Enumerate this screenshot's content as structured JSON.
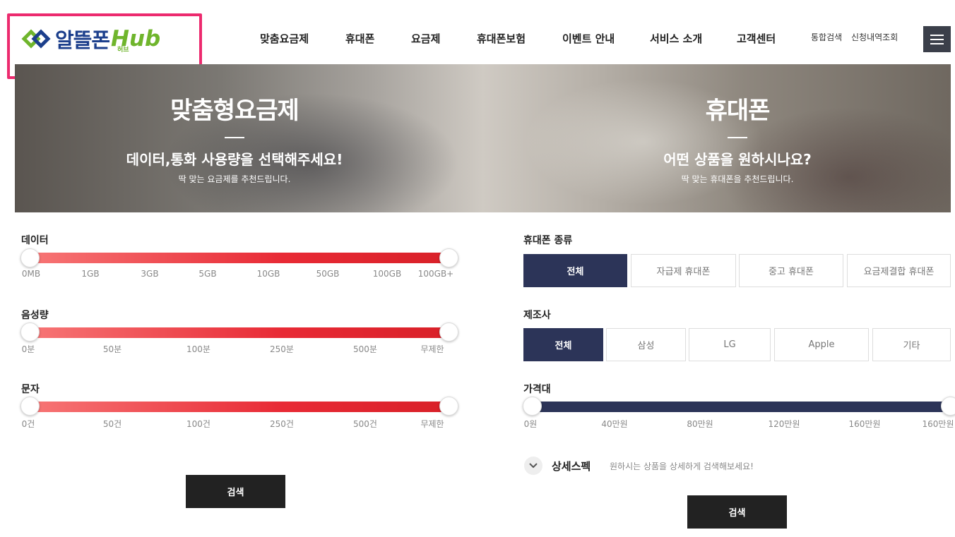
{
  "header": {
    "logo_text": "알뜰폰",
    "logo_hub": "Hub",
    "logo_sub": "허브",
    "nav": [
      "맞춤요금제",
      "휴대폰",
      "요금제",
      "휴대폰보험",
      "이벤트 안내",
      "서비스 소개",
      "고객센터"
    ],
    "util_search": "통합검색",
    "util_history": "신청내역조회"
  },
  "banner": {
    "left": {
      "title": "맞춤형요금제",
      "subtitle": "데이터,통화 사용량을 선택해주세요!",
      "small": "딱 맞는 요금제를 추천드립니다."
    },
    "right": {
      "title": "휴대폰",
      "subtitle": "어떤 상품을 원하시나요?",
      "small": "딱 맞는 휴대폰을 추천드립니다."
    }
  },
  "plan": {
    "data": {
      "label": "데이터",
      "ticks": [
        "0MB",
        "1GB",
        "3GB",
        "5GB",
        "10GB",
        "50GB",
        "100GB",
        "100GB+"
      ],
      "min_index": 0,
      "max_index": 7
    },
    "voice": {
      "label": "음성량",
      "ticks": [
        "0분",
        "50분",
        "100분",
        "250분",
        "500분",
        "무제한"
      ],
      "min_index": 0,
      "max_index": 5
    },
    "sms": {
      "label": "문자",
      "ticks": [
        "0건",
        "50건",
        "100건",
        "250건",
        "500건",
        "무제한"
      ],
      "min_index": 0,
      "max_index": 5
    },
    "search_label": "검색"
  },
  "phone": {
    "type": {
      "label": "휴대폰 종류",
      "options": [
        "전체",
        "자급제 휴대폰",
        "중고 휴대폰",
        "요금제결합 휴대폰"
      ],
      "selected": "전체"
    },
    "maker": {
      "label": "제조사",
      "options": [
        "전체",
        "삼성",
        "LG",
        "Apple",
        "기타"
      ],
      "selected": "전체"
    },
    "price": {
      "label": "가격대",
      "ticks": [
        "0원",
        "40만원",
        "80만원",
        "120만원",
        "160만원",
        "160만원"
      ],
      "min_index": 0,
      "max_index": 5
    },
    "detail_title": "상세스펙",
    "detail_desc": "원하시는 상품을 상세하게 검색해보세요!",
    "search_label": "검색"
  }
}
